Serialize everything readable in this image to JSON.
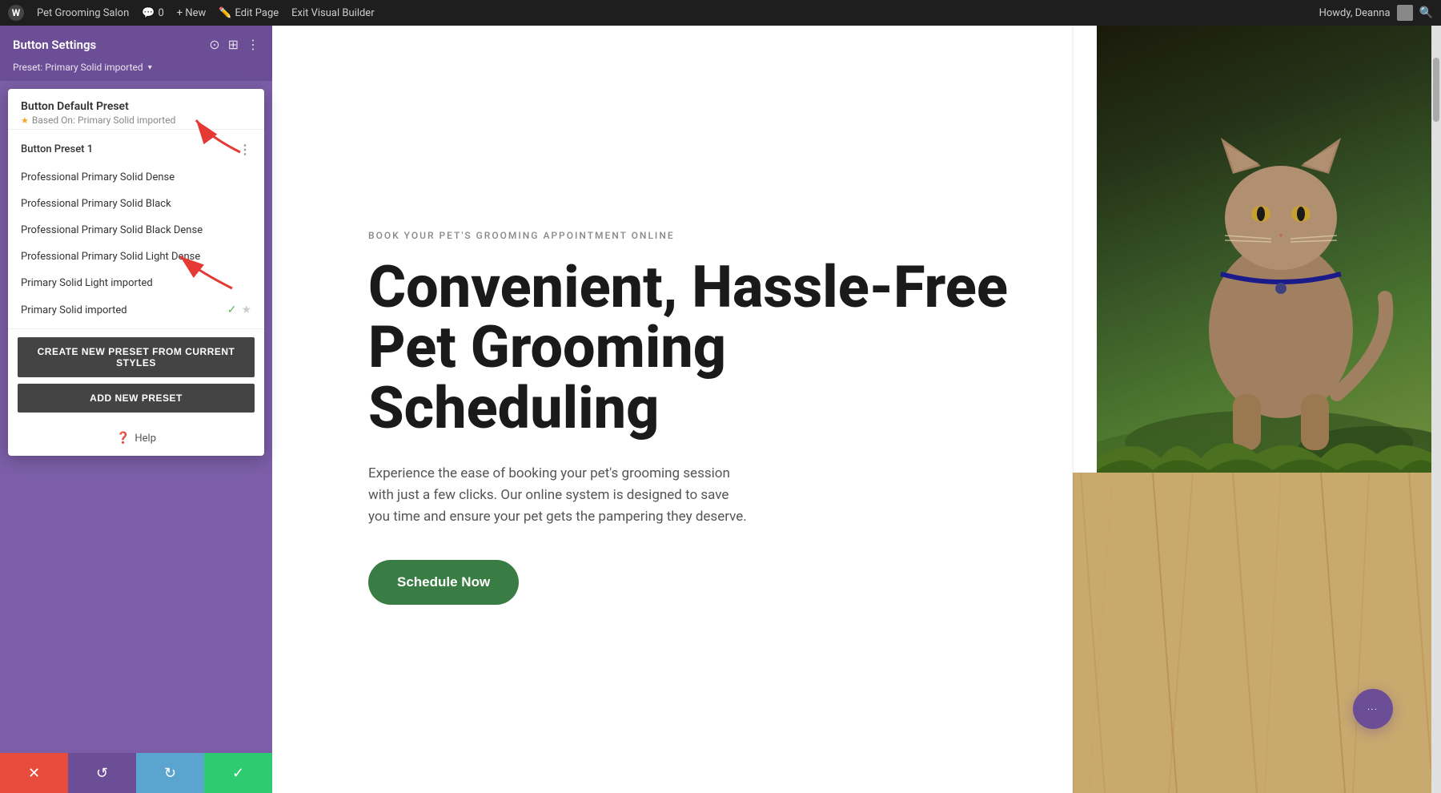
{
  "adminBar": {
    "wpLogoText": "W",
    "siteName": "Pet Grooming Salon",
    "commentCount": "0",
    "newLabel": "+ New",
    "editPageLabel": "Edit Page",
    "exitBuilderLabel": "Exit Visual Builder",
    "howdy": "Howdy, Deanna"
  },
  "panel": {
    "title": "Button Settings",
    "presetLabel": "Preset: Primary Solid imported",
    "presetChevron": "▾",
    "icons": {
      "columns": "⊞",
      "more": "⋮",
      "target": "⊙"
    }
  },
  "dropdown": {
    "defaultPreset": {
      "name": "Button Default Preset",
      "basedOn": "Based On: Primary Solid imported"
    },
    "presets": [
      {
        "name": "Button Preset 1",
        "hasDots": true,
        "hasCheck": false,
        "hasStar": false
      },
      {
        "name": "Professional Primary Solid Dense",
        "hasDots": false,
        "hasCheck": false,
        "hasStar": false
      },
      {
        "name": "Professional Primary Solid Black",
        "hasDots": false,
        "hasCheck": false,
        "hasStar": false
      },
      {
        "name": "Professional Primary Solid Black Dense",
        "hasDots": false,
        "hasCheck": false,
        "hasStar": false
      },
      {
        "name": "Professional Primary Solid Light Dense",
        "hasDots": false,
        "hasCheck": false,
        "hasStar": false
      },
      {
        "name": "Primary Solid Light imported",
        "hasDots": false,
        "hasCheck": false,
        "hasStar": false
      },
      {
        "name": "Primary Solid imported",
        "hasDots": false,
        "hasCheck": true,
        "hasStar": true
      }
    ],
    "createButton": "CREATE NEW PRESET FROM CURRENT STYLES",
    "addButton": "ADD NEW PRESET",
    "helpLabel": "Help"
  },
  "bottomBar": {
    "cancelIcon": "✕",
    "undoIcon": "↺",
    "redoIcon": "↻",
    "confirmIcon": "✓"
  },
  "hero": {
    "eyebrow": "BOOK YOUR PET'S GROOMING APPOINTMENT ONLINE",
    "title": "Convenient, Hassle-Free Pet Grooming Scheduling",
    "description": "Experience the ease of booking your pet's grooming session with just a few clicks. Our online system is designed to save you time and ensure your pet gets the pampering they deserve.",
    "buttonLabel": "Schedule Now",
    "fabIcon": "•••"
  }
}
